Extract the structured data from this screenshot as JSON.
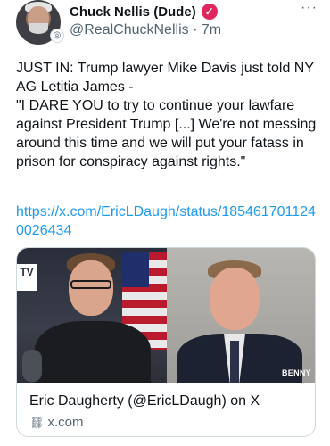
{
  "author": {
    "display_name": "Chuck Nellis (Dude)",
    "handle": "@RealChuckNellis",
    "separator": "·",
    "time": "7m",
    "verified_icon": "check-badge-icon",
    "more_icon": "more-icon"
  },
  "tweet": {
    "text": "JUST IN: Trump lawyer Mike Davis just told NY AG Letitia James -\n\"I DARE YOU to try to continue your lawfare against President Trump [...] We're not messing around this time and we will put your fatass in prison for conspiracy against rights.\"",
    "link": "https://x.com/EricLDaugh/status/1854617011240026434"
  },
  "card": {
    "title": "Eric Daugherty (@EricLDaugh) on X",
    "domain": "x.com",
    "watermark": "BENNY",
    "logo_text": "TV"
  },
  "colors": {
    "link": "#1d9bf0",
    "muted": "#536471",
    "verified": "#e0245e"
  }
}
